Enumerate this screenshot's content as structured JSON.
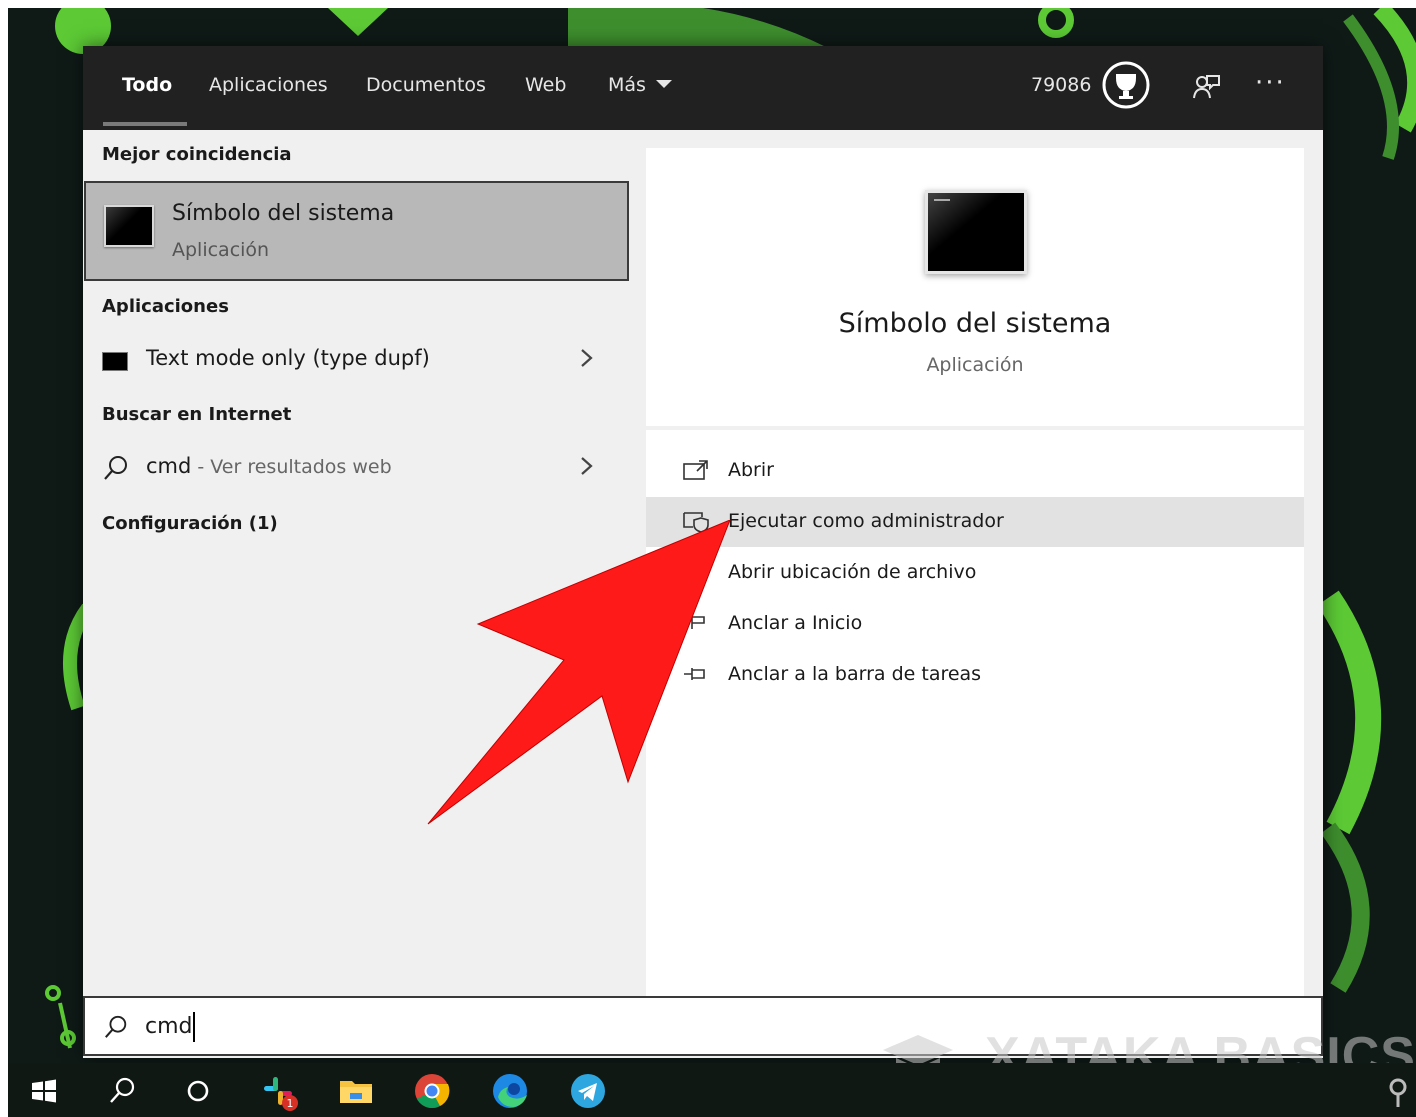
{
  "tabs": [
    {
      "label": "Todo",
      "active": true
    },
    {
      "label": "Aplicaciones",
      "active": false
    },
    {
      "label": "Documentos",
      "active": false
    },
    {
      "label": "Web",
      "active": false
    },
    {
      "label": "Más",
      "active": false
    }
  ],
  "header": {
    "points": "79086",
    "icons": [
      "trophy-icon",
      "feedback-icon",
      "more-options-icon"
    ]
  },
  "left": {
    "best_match_header": "Mejor coincidencia",
    "best_match": {
      "title": "Símbolo del sistema",
      "subtitle": "Aplicación"
    },
    "apps_header": "Aplicaciones",
    "apps": [
      {
        "label": "Text mode only (type dupf)"
      }
    ],
    "web_header": "Buscar en Internet",
    "web": {
      "query": "cmd",
      "suffix": " - Ver resultados web"
    },
    "settings_header": "Configuración (1)"
  },
  "preview": {
    "title": "Símbolo del sistema",
    "subtitle": "Aplicación"
  },
  "actions": [
    {
      "label": "Abrir",
      "icon": "open-icon"
    },
    {
      "label": "Ejecutar como administrador",
      "icon": "admin-shield-icon",
      "highlighted": true
    },
    {
      "label": "Abrir ubicación de archivo",
      "icon": "folder-icon"
    },
    {
      "label": "Anclar a Inicio",
      "icon": "pin-icon"
    },
    {
      "label": "Anclar a la barra de tareas",
      "icon": "pin-taskbar-icon"
    }
  ],
  "search": {
    "value": "cmd"
  },
  "taskbar": {
    "icons": [
      "windows-start-icon",
      "search-icon",
      "cortana-icon",
      "slack-icon",
      "file-explorer-icon",
      "chrome-icon",
      "edge-icon",
      "telegram-icon"
    ],
    "slack_badge": "1"
  },
  "watermark": "XATAKA BASICS",
  "colors": {
    "arrow": "#ff1a1a",
    "accent_dark": "#212121",
    "highlight": "#e2e2e2"
  }
}
